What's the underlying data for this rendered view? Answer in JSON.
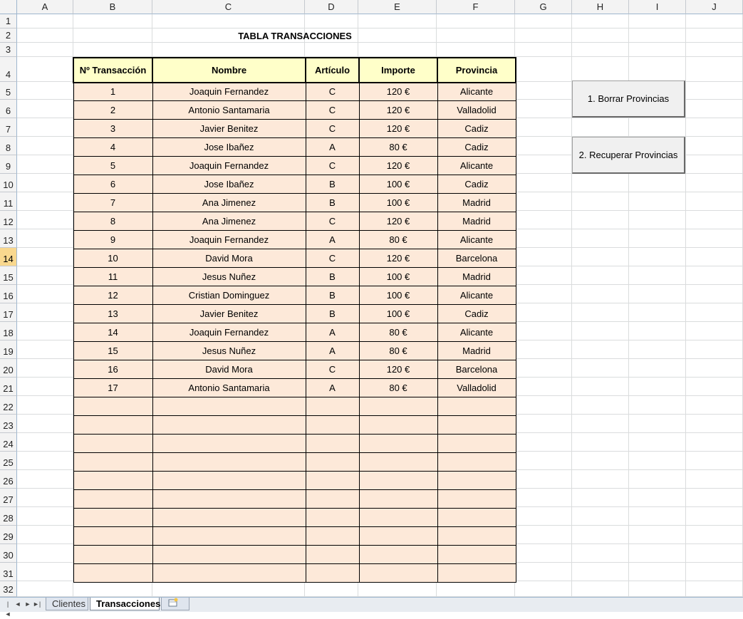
{
  "columns": [
    "A",
    "B",
    "C",
    "D",
    "E",
    "F",
    "G",
    "H",
    "I",
    "J"
  ],
  "rows": [
    "1",
    "2",
    "3",
    "4",
    "5",
    "6",
    "7",
    "8",
    "9",
    "10",
    "11",
    "12",
    "13",
    "14",
    "15",
    "16",
    "17",
    "18",
    "19",
    "20",
    "21",
    "22",
    "23",
    "24",
    "25",
    "26",
    "27",
    "28",
    "29",
    "30",
    "31",
    "32"
  ],
  "active_row": "14",
  "title": "TABLA TRANSACCIONES",
  "table": {
    "headers": [
      "Nº Transacción",
      "Nombre",
      "Artículo",
      "Importe",
      "Provincia"
    ],
    "rows": [
      [
        "1",
        "Joaquin Fernandez",
        "C",
        "120 €",
        "Alicante"
      ],
      [
        "2",
        "Antonio Santamaria",
        "C",
        "120 €",
        "Valladolid"
      ],
      [
        "3",
        "Javier Benitez",
        "C",
        "120 €",
        "Cadiz"
      ],
      [
        "4",
        "Jose Ibañez",
        "A",
        "80 €",
        "Cadiz"
      ],
      [
        "5",
        "Joaquin Fernandez",
        "C",
        "120 €",
        "Alicante"
      ],
      [
        "6",
        "Jose Ibañez",
        "B",
        "100 €",
        "Cadiz"
      ],
      [
        "7",
        "Ana Jimenez",
        "B",
        "100 €",
        "Madrid"
      ],
      [
        "8",
        "Ana Jimenez",
        "C",
        "120 €",
        "Madrid"
      ],
      [
        "9",
        "Joaquin Fernandez",
        "A",
        "80 €",
        "Alicante"
      ],
      [
        "10",
        "David Mora",
        "C",
        "120 €",
        "Barcelona"
      ],
      [
        "11",
        "Jesus Nuñez",
        "B",
        "100 €",
        "Madrid"
      ],
      [
        "12",
        "Cristian Dominguez",
        "B",
        "100 €",
        "Alicante"
      ],
      [
        "13",
        "Javier Benitez",
        "B",
        "100 €",
        "Cadiz"
      ],
      [
        "14",
        "Joaquin Fernandez",
        "A",
        "80 €",
        "Alicante"
      ],
      [
        "15",
        "Jesus Nuñez",
        "A",
        "80 €",
        "Madrid"
      ],
      [
        "16",
        "David Mora",
        "C",
        "120 €",
        "Barcelona"
      ],
      [
        "17",
        "Antonio Santamaria",
        "A",
        "80 €",
        "Valladolid"
      ]
    ],
    "empty_rows": 10
  },
  "buttons": {
    "borrar": "1. Borrar Provincias",
    "recuperar": "2. Recuperar Provincias"
  },
  "tabs": {
    "clientes": "Clientes",
    "transacciones": "Transacciones",
    "new_sheet_icon": "new-sheet-icon",
    "nav_icons": [
      "first-sheet-icon",
      "prev-sheet-icon",
      "next-sheet-icon",
      "last-sheet-icon"
    ]
  }
}
